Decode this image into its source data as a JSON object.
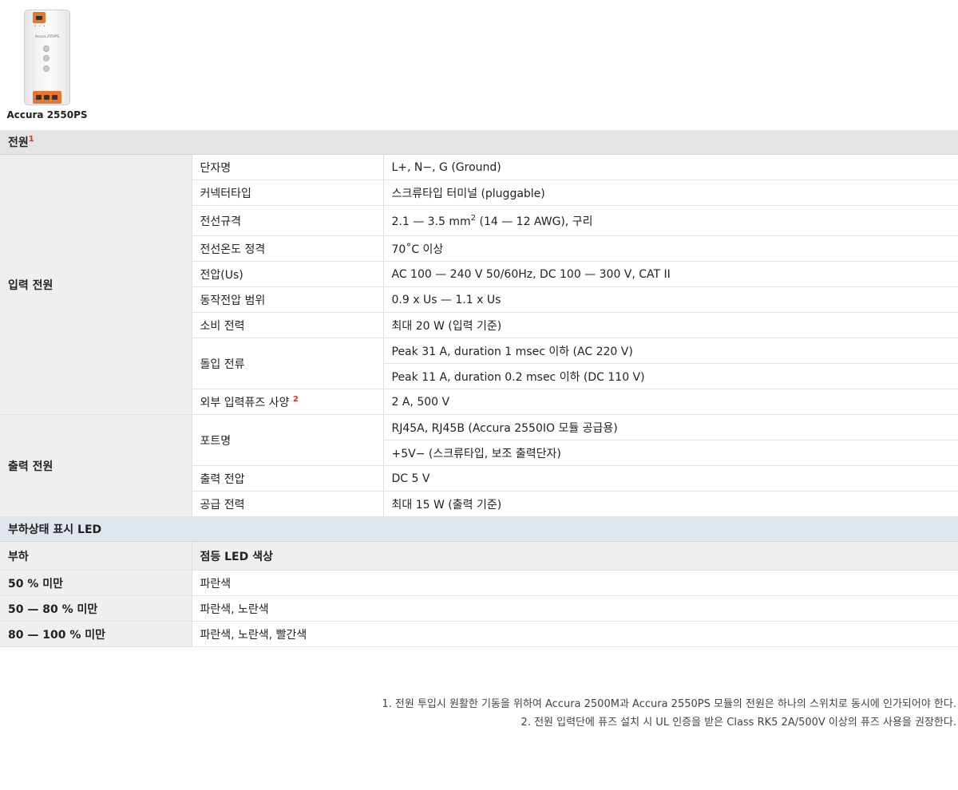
{
  "product": {
    "name": "Accura 2550PS",
    "device_label": "Accura 2550PS",
    "colors": {
      "terminal": "#e8762c",
      "body": "#f4f4f4"
    }
  },
  "power": {
    "heading": "전원",
    "heading_note": "1",
    "input": {
      "label": "입력 전원",
      "rows": [
        {
          "key": "단자명",
          "value": "L+, N−, G (Ground)"
        },
        {
          "key": "커넥터타입",
          "value": "스크류타입 터미널 (pluggable)"
        },
        {
          "key": "전선규격",
          "value_pre": "2.1 — 3.5 mm",
          "value_sup": "2",
          "value_post": " (14 — 12 AWG), 구리"
        },
        {
          "key": "전선온도 정격",
          "value": "70˚C 이상"
        },
        {
          "key": "전압(Us)",
          "value": "AC 100 — 240 V 50/60Hz, DC 100 — 300 V, CAT II"
        },
        {
          "key": "동작전압 범위",
          "value": "0.9 x Us — 1.1 x Us"
        },
        {
          "key": "소비 전력",
          "value": "최대 20 W (입력 기준)"
        },
        {
          "key": "돌입 전류",
          "values": [
            "Peak 31 A, duration 1 msec 이하 (AC 220 V)",
            "Peak 11 A, duration 0.2 msec 이하 (DC 110 V)"
          ]
        },
        {
          "key": "외부 입력퓨즈 사양",
          "key_note": "2",
          "value": "2 A, 500 V"
        }
      ]
    },
    "output": {
      "label": "출력 전원",
      "rows": [
        {
          "key": "포트명",
          "values": [
            "RJ45A, RJ45B (Accura 2550IO 모듈 공급용)",
            "+5V− (스크류타입, 보조 출력단자)"
          ]
        },
        {
          "key": "출력 전압",
          "value": "DC 5 V"
        },
        {
          "key": "공급 전력",
          "value": "최대 15 W (출력 기준)"
        }
      ]
    }
  },
  "led": {
    "heading": "부하상태 표시 LED",
    "col_load": "부하",
    "col_color": "점등 LED 색상",
    "rows": [
      {
        "load": "50 % 미만",
        "color": "파란색"
      },
      {
        "load": "50 — 80 % 미만",
        "color": "파란색, 노란색"
      },
      {
        "load": "80 — 100 % 미만",
        "color": "파란색, 노란색, 빨간색"
      }
    ]
  },
  "notes": [
    "1. 전원 투입시 원활한 기동을 위하여 Accura 2500M과 Accura 2550PS 모듈의 전원은 하나의 스위치로 동시에 인가되어야 한다.",
    "2. 전원 입력단에 퓨즈 설치 시 UL 인증을 받은 Class RK5 2A/500V 이상의 퓨즈 사용을 권장한다."
  ]
}
